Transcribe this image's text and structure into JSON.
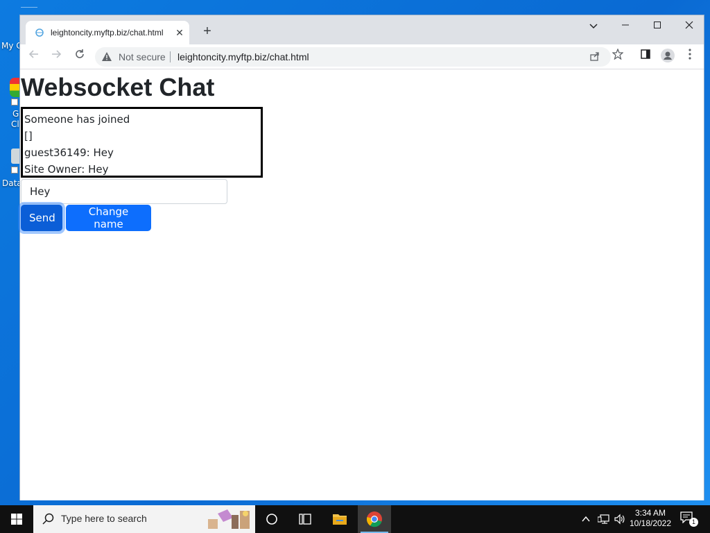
{
  "desktop": {
    "icons": [
      {
        "label": "My C"
      },
      {
        "label": "G"
      },
      {
        "label": "Cl"
      },
      {
        "label": "Data"
      }
    ]
  },
  "browser": {
    "tab": {
      "title": "leightoncity.myftp.biz/chat.html",
      "close_glyph": "✕"
    },
    "new_tab_glyph": "+",
    "security_label": "Not secure",
    "url": "leightoncity.myftp.biz/chat.html"
  },
  "page": {
    "title": "Websocket Chat",
    "messages": [
      "Someone has joined",
      "[]",
      "guest36149: Hey",
      "Site Owner: Hey"
    ],
    "input_value": "Hey",
    "send_label": "Send",
    "change_name_label": "Change name"
  },
  "taskbar": {
    "search_placeholder": "Type here to search",
    "time": "3:34 AM",
    "date": "10/18/2022",
    "notification_count": "1"
  },
  "colors": {
    "primary": "#0d6efd",
    "desktop": "#0a6fd6",
    "taskbar": "#101010"
  }
}
